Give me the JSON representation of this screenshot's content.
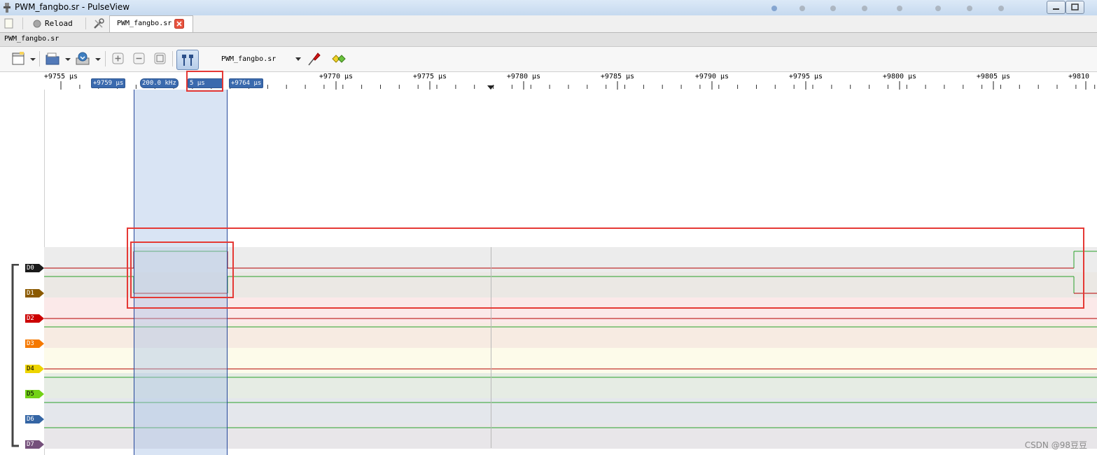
{
  "window": {
    "title": "PWM_fangbo.sr - PulseView"
  },
  "tabbar": {
    "reload_label": "Reload",
    "file_tab_label": "PWM_fangbo.sr"
  },
  "session": {
    "name": "PWM_fangbo.sr"
  },
  "toolbar": {
    "device_selected": "PWM_fangbo.sr"
  },
  "ruler": {
    "ticks": [
      {
        "label": "+9755 µs"
      },
      {
        "label": "+9770 µs"
      },
      {
        "label": "+9775 µs"
      },
      {
        "label": "+9780 µs"
      },
      {
        "label": "+9785 µs"
      },
      {
        "label": "+9790 µs"
      },
      {
        "label": "+9795 µs"
      },
      {
        "label": "+9800 µs"
      },
      {
        "label": "+9805 µs"
      },
      {
        "label": "+9810"
      }
    ],
    "cursor_a_label": "+9759 µs",
    "cursor_freq_label": "200.0 kHz",
    "cursor_period_label": "5 µs",
    "cursor_b_label": "+9764 µs"
  },
  "channels": [
    {
      "name": "D0",
      "color": "#1a1a1a",
      "band": "#ececec"
    },
    {
      "name": "D1",
      "color": "#8b5a00",
      "band": "#ebe8e4"
    },
    {
      "name": "D2",
      "color": "#cc0000",
      "band": "#fbe9e9"
    },
    {
      "name": "D3",
      "color": "#f57900",
      "band": "#f7ebe2"
    },
    {
      "name": "D4",
      "color": "#edd400",
      "band": "#fdfbea"
    },
    {
      "name": "D5",
      "color": "#73d216",
      "band": "#e6ece4"
    },
    {
      "name": "D6",
      "color": "#3465a4",
      "band": "#e4e7ec"
    },
    {
      "name": "D7",
      "color": "#75507b",
      "band": "#e8e6e9"
    }
  ],
  "colors": {
    "signal_low": "#b40000",
    "signal_high": "#2aa12a",
    "cursor_region": "#c7d6ea",
    "cursor_line": "#25479a",
    "annotation": "#e53935"
  },
  "watermark": "CSDN @98豆豆"
}
